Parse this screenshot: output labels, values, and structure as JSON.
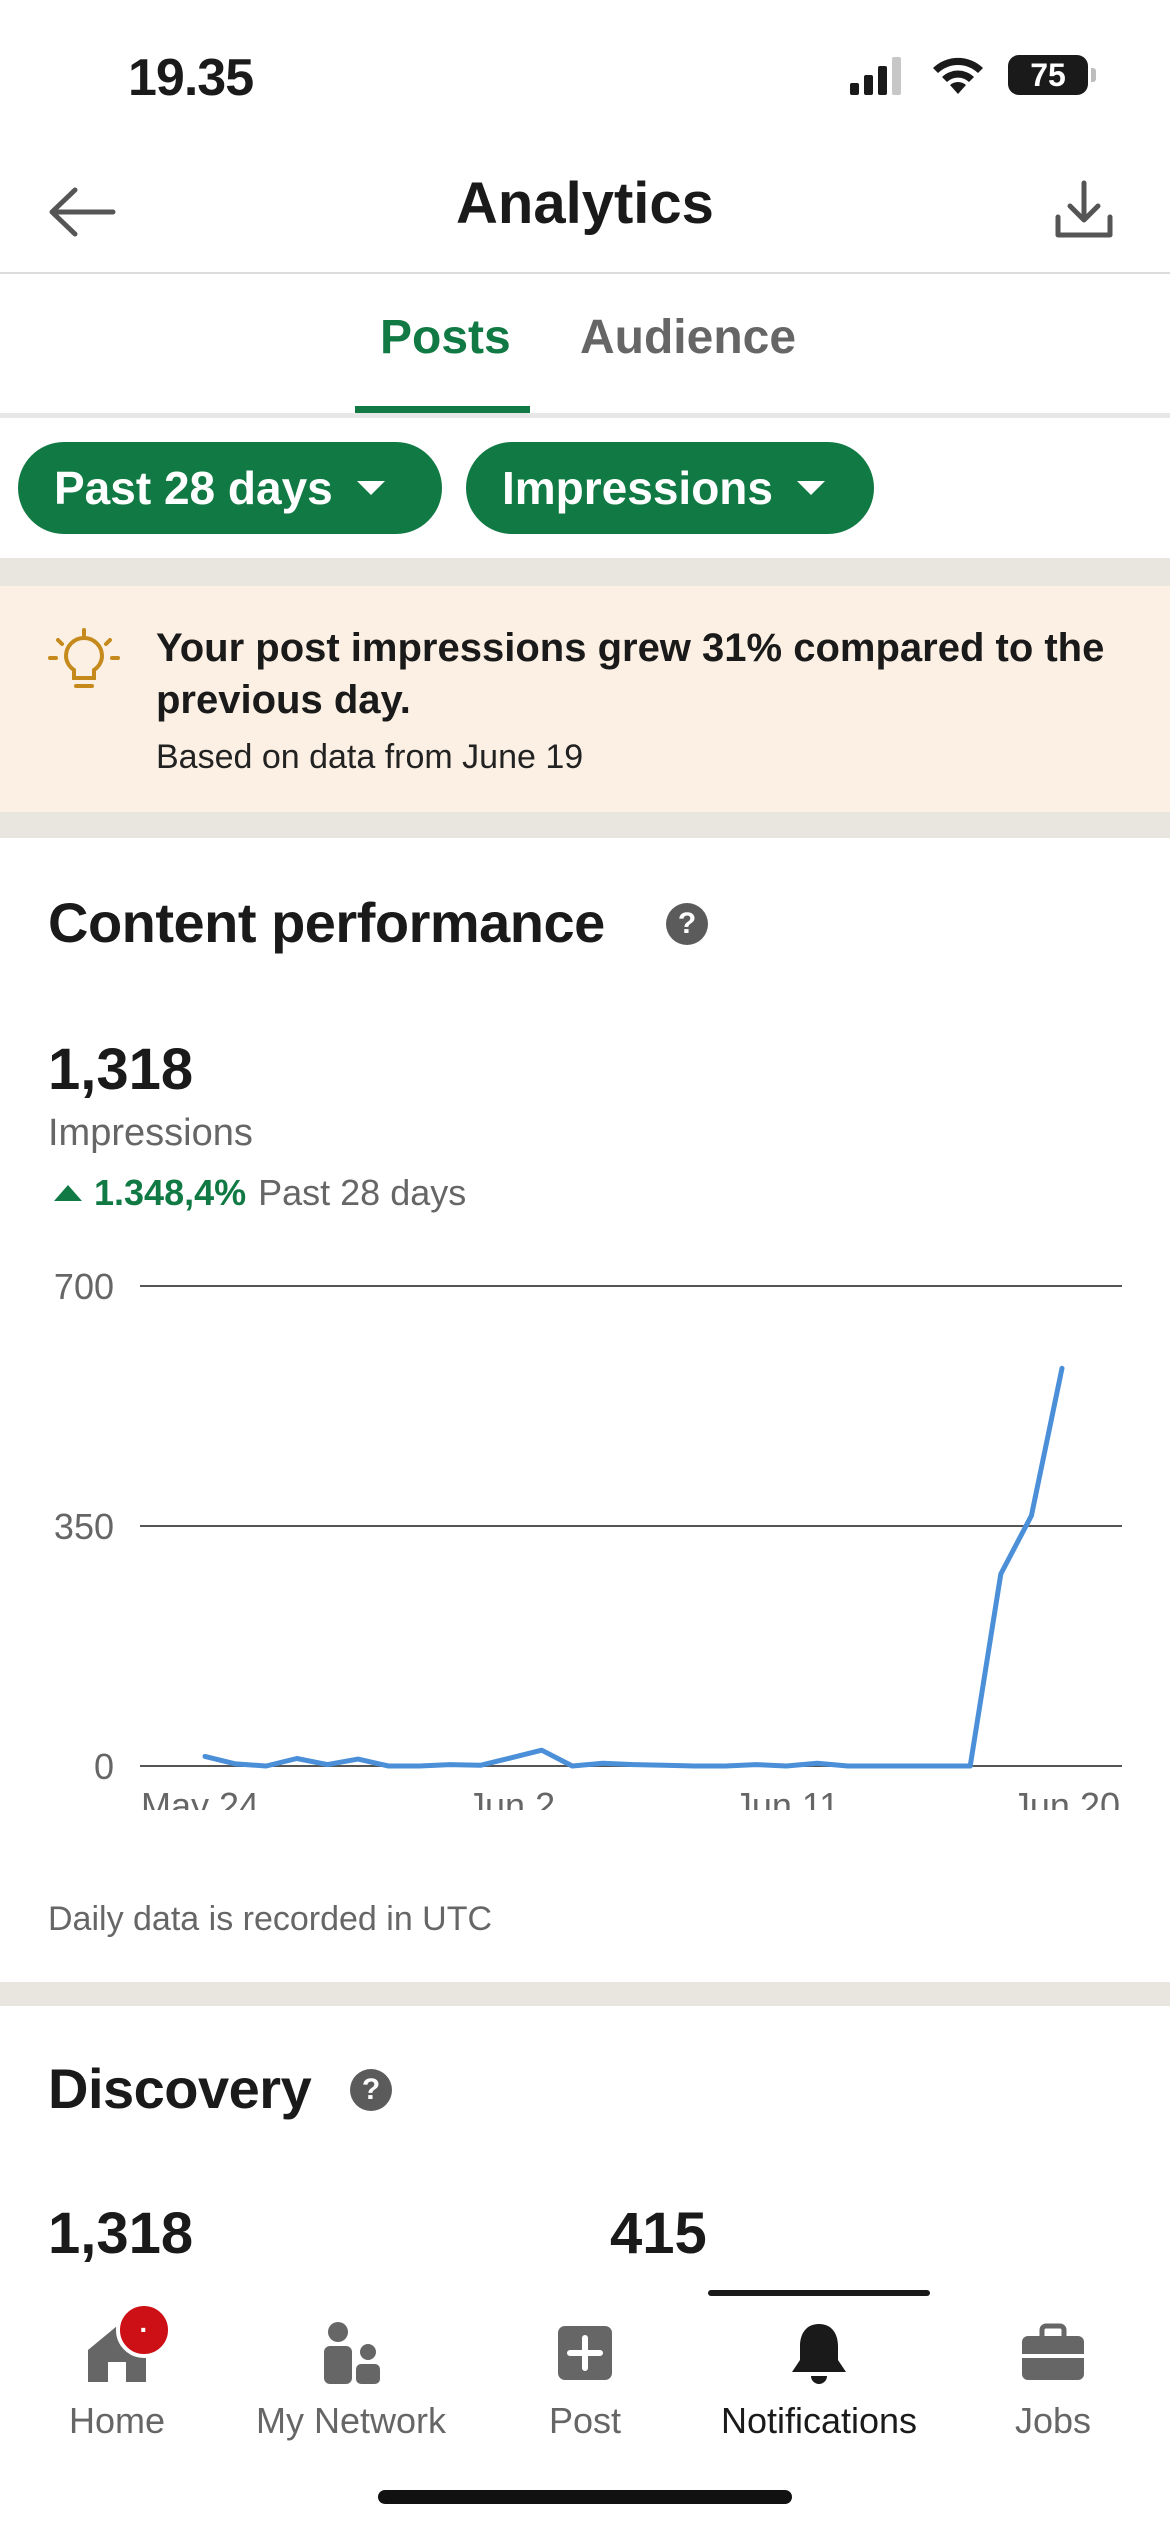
{
  "status_bar": {
    "time": "19.35",
    "battery": "75"
  },
  "header": {
    "title": "Analytics",
    "back_icon": "arrow-left-icon",
    "download_icon": "download-icon"
  },
  "tabs": [
    {
      "label": "Posts",
      "active": true
    },
    {
      "label": "Audience",
      "active": false
    }
  ],
  "filters": {
    "range": "Past 28 days",
    "metric": "Impressions"
  },
  "insight": {
    "icon": "lightbulb-icon",
    "title": "Your post impressions grew 31% compared to the previous day.",
    "subtitle": "Based on data from June 19"
  },
  "content_performance": {
    "title": "Content performance",
    "help": "?",
    "value": "1,318",
    "label": "Impressions",
    "growth": "1.348,4%",
    "growth_period": "Past 28 days",
    "note": "Daily data is recorded in UTC"
  },
  "chart_data": {
    "type": "line",
    "x": [
      "May 23",
      "May 24",
      "May 25",
      "May 26",
      "May 27",
      "May 28",
      "May 29",
      "May 30",
      "May 31",
      "Jun 1",
      "Jun 2",
      "Jun 3",
      "Jun 4",
      "Jun 5",
      "Jun 6",
      "Jun 7",
      "Jun 8",
      "Jun 9",
      "Jun 10",
      "Jun 11",
      "Jun 12",
      "Jun 13",
      "Jun 14",
      "Jun 15",
      "Jun 16",
      "Jun 17",
      "Jun 18",
      "Jun 19",
      "Jun 20"
    ],
    "values": [
      14,
      3,
      0,
      11,
      2,
      10,
      0,
      0,
      2,
      1,
      12,
      23,
      0,
      4,
      2,
      1,
      0,
      0,
      2,
      0,
      4,
      0,
      0,
      0,
      0,
      0,
      280,
      365,
      580
    ],
    "xticks": [
      "May 24",
      "Jun 2",
      "Jun 11",
      "Jun 20"
    ],
    "yticks": [
      "0",
      "350",
      "700"
    ],
    "ylim": [
      0,
      700
    ],
    "series_color": "#4a8fd8",
    "grid": true,
    "title": "",
    "xlabel": "",
    "ylabel": ""
  },
  "discovery": {
    "title": "Discovery",
    "help": "?",
    "impressions": "1,318",
    "members_reached": "415"
  },
  "bottom_nav": [
    {
      "label": "Home",
      "icon": "home-icon",
      "badge": "·"
    },
    {
      "label": "My Network",
      "icon": "network-icon"
    },
    {
      "label": "Post",
      "icon": "add-post-icon"
    },
    {
      "label": "Notifications",
      "icon": "bell-icon",
      "active": true
    },
    {
      "label": "Jobs",
      "icon": "briefcase-icon"
    }
  ],
  "colors": {
    "accent_green": "#117a44",
    "banner_bg": "#fbf0e3",
    "chart_line": "#4a8fd8",
    "badge_red": "#cc1016"
  }
}
